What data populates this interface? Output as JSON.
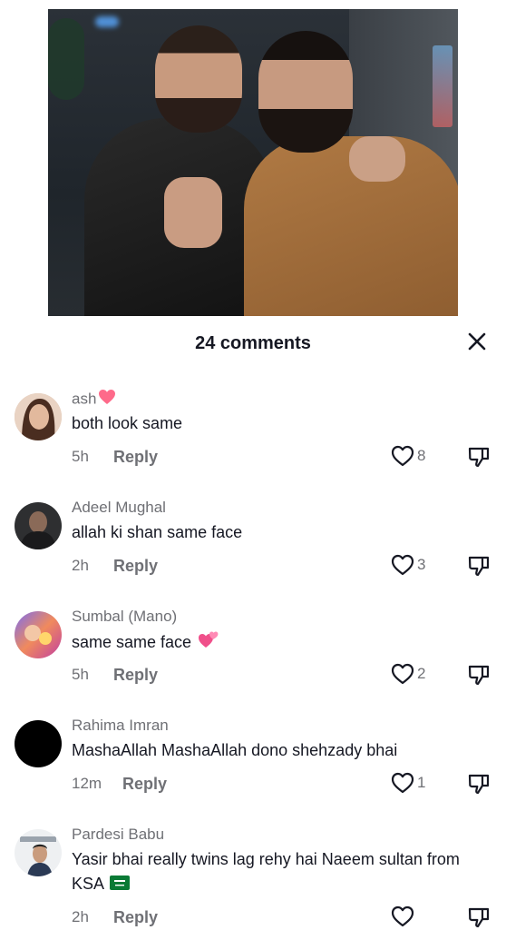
{
  "sheet": {
    "title": "24 comments"
  },
  "comments": [
    {
      "username": "ash",
      "username_emoji": "heart",
      "text": "both look same",
      "time": "5h",
      "reply_label": "Reply",
      "likes": "8",
      "avatar": "woman-portrait"
    },
    {
      "username": "Adeel Mughal",
      "text": "allah ki shan same face",
      "time": "2h",
      "reply_label": "Reply",
      "likes": "3",
      "avatar": "man-dark-portrait"
    },
    {
      "username": "Sumbal (Mano)",
      "text": "same same face",
      "text_emoji": "two-hearts",
      "time": "5h",
      "reply_label": "Reply",
      "likes": "2",
      "avatar": "colorful-art"
    },
    {
      "username": "Rahima Imran",
      "text": "MashaAllah MashaAllah dono shehzady bhai",
      "time": "12m",
      "reply_label": "Reply",
      "likes": "1",
      "avatar": "black-circle"
    },
    {
      "username": "Pardesi Babu",
      "text": "Yasir bhai really twins lag rehy hai Naeem sultan from KSA",
      "text_emoji": "saudi-flag",
      "time": "2h",
      "reply_label": "Reply",
      "likes": "",
      "avatar": "man-light-portrait"
    }
  ],
  "colors": {
    "text_primary": "#161823",
    "text_secondary": "#6f7075",
    "heart_pink": "#fe6a8a"
  }
}
